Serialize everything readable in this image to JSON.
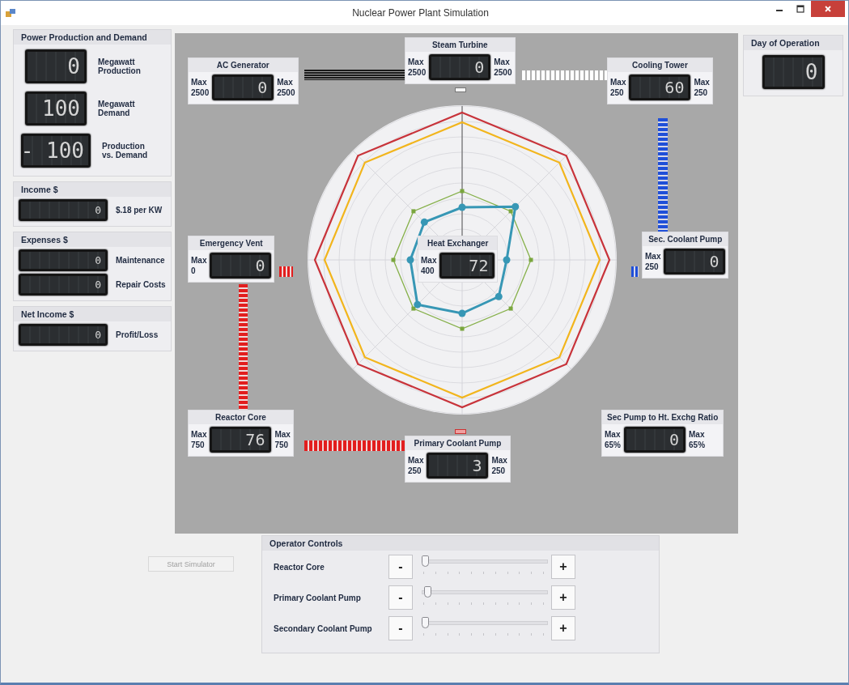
{
  "window": {
    "title": "Nuclear Power Plant Simulation"
  },
  "panels": [
    {
      "title": "Power Production and Demand",
      "kind": "large",
      "readouts": [
        {
          "value": "0",
          "label": "Megawatt Production"
        },
        {
          "value": "100",
          "label": "Megawatt Demand"
        },
        {
          "value": "- 100",
          "label": "Production vs. Demand"
        }
      ]
    },
    {
      "title": "Income $",
      "kind": "wide",
      "readouts": [
        {
          "value": "0",
          "label": "$.18 per KW"
        }
      ]
    },
    {
      "title": "Expenses $",
      "kind": "wide",
      "readouts": [
        {
          "value": "0",
          "label": "Maintenance"
        },
        {
          "value": "0",
          "label": "Repair Costs"
        }
      ]
    },
    {
      "title": "Net Income $",
      "kind": "wide",
      "readouts": [
        {
          "value": "0",
          "label": "Profit/Loss"
        }
      ]
    }
  ],
  "plant": {
    "gauges": [
      {
        "title": "AC Generator",
        "left_label": "Max 2500",
        "value": "0",
        "right_label": "Max 2500"
      },
      {
        "title": "Steam Turbine",
        "left_label": "Max 2500",
        "value": "0",
        "right_label": "Max 2500"
      },
      {
        "title": "Cooling Tower",
        "left_label": "Max 250",
        "value": "60",
        "right_label": "Max 250"
      },
      {
        "title": "Emergency Vent",
        "left_label": "Max 0",
        "value": "0"
      },
      {
        "title": "Heat Exchanger",
        "left_label": "Max 400",
        "value": "72"
      },
      {
        "title": "Sec. Coolant Pump",
        "left_label": "Max 250",
        "value": "0"
      },
      {
        "title": "Reactor Core",
        "left_label": "Max 750",
        "value": "76",
        "right_label": "Max 750"
      },
      {
        "title": "Primary Coolant Pump",
        "left_label": "Max 250",
        "value": "3",
        "right_label": "Max 250"
      },
      {
        "title": "Sec Pump to Ht. Exchg Ratio",
        "left_label": "Max 65%",
        "value": "0",
        "right_label": "Max 65%"
      }
    ]
  },
  "day_of_operation": {
    "title": "Day of Operation",
    "value": "0"
  },
  "start_button": {
    "label": "Start Simulator",
    "disabled": true
  },
  "operator_controls": {
    "title": "Operator Controls",
    "rows": [
      {
        "label": "Reactor Core",
        "decrease": "-",
        "increase": "+",
        "level": 0
      },
      {
        "label": "Primary Coolant Pump",
        "decrease": "-",
        "increase": "+",
        "level": 0.02
      },
      {
        "label": "Secondary Coolant Pump",
        "decrease": "-",
        "increase": "+",
        "level": 0
      }
    ]
  }
}
